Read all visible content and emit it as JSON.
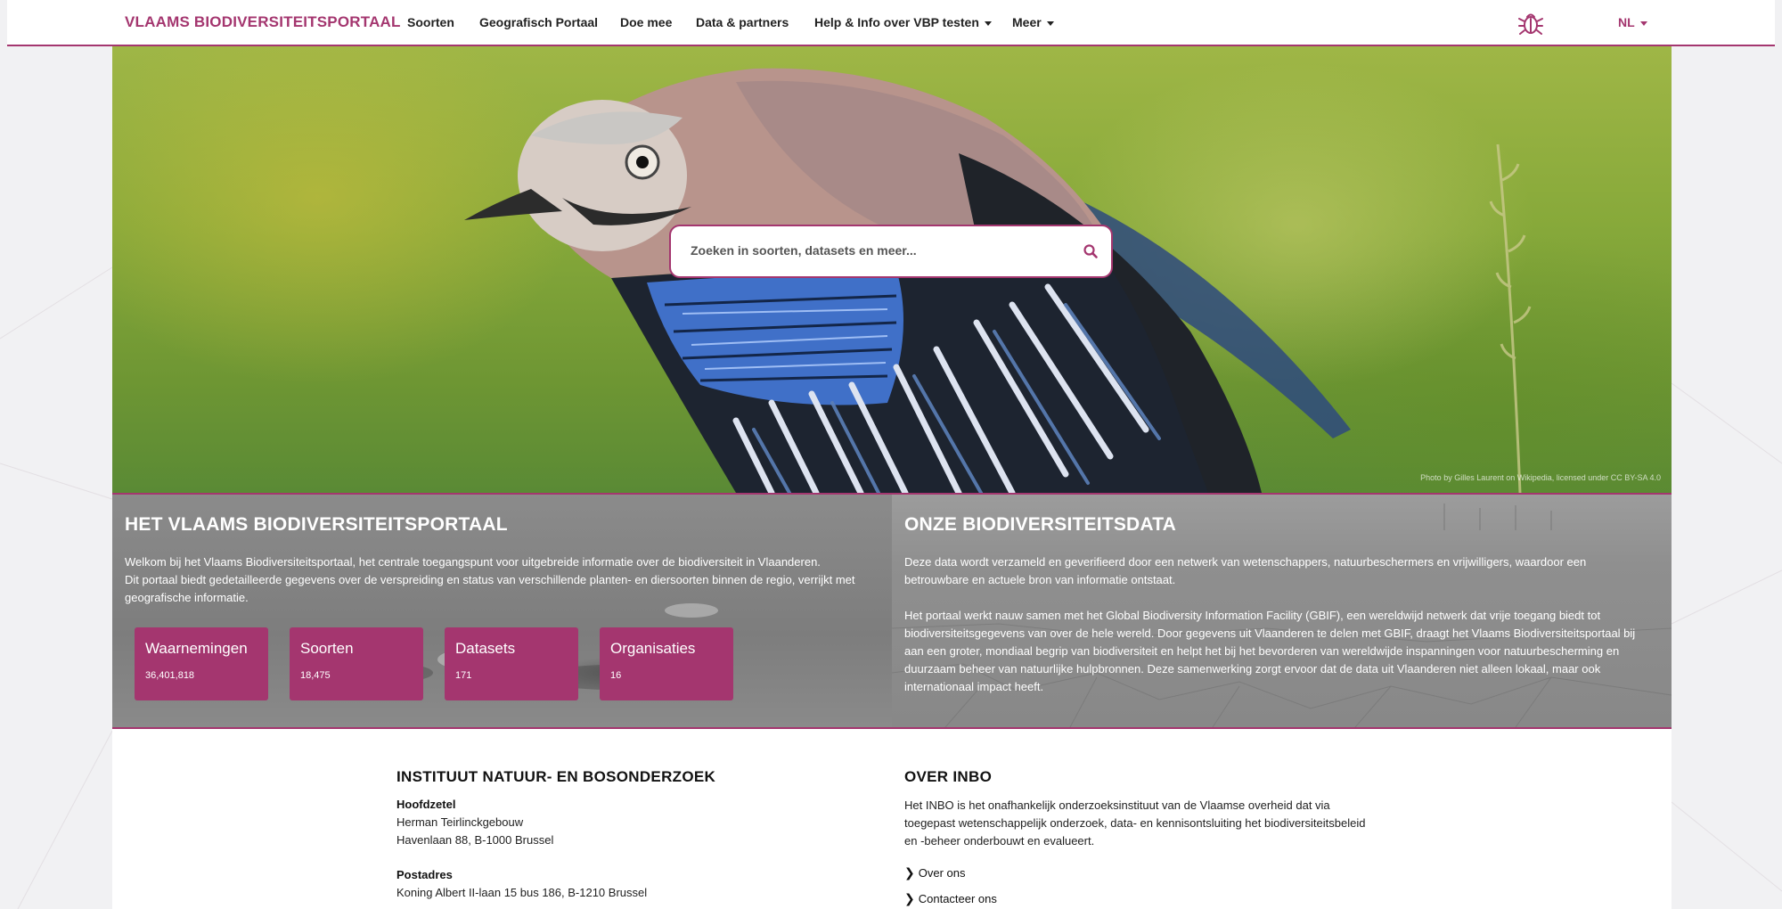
{
  "nav": {
    "brand": "VLAAMS BIODIVERSITEITSPORTAAL",
    "items": [
      {
        "label": "Soorten",
        "dropdown": false
      },
      {
        "label": "Geografisch Portaal",
        "dropdown": false
      },
      {
        "label": "Doe mee",
        "dropdown": false
      },
      {
        "label": "Data & partners",
        "dropdown": false
      },
      {
        "label": "Help & Info over VBP testen",
        "dropdown": true
      },
      {
        "label": "Meer",
        "dropdown": true
      }
    ],
    "language": "NL",
    "bug_icon": "bug-icon",
    "accent": "#a4366f"
  },
  "hero": {
    "search_placeholder": "Zoeken in soorten, datasets en meer...",
    "photo_credit": "Photo by Gilles Laurent on Wikipedia, licensed under CC BY-SA 4.0"
  },
  "intro": {
    "title": "HET VLAAMS BIODIVERSITEITSPORTAAL",
    "paragraph1": "Welkom bij het Vlaams Biodiversiteitsportaal, het centrale toegangspunt voor uitgebreide informatie over de biodiversiteit in Vlaanderen.",
    "paragraph2_line1": "Dit portaal biedt gedetailleerde gegevens over de verspreiding en status van verschillende planten- en diersoorten binnen de regio, verrijkt met",
    "paragraph2_line2": "geografische informatie.",
    "stats": [
      {
        "label": "Waarnemingen",
        "value": "36,401,818"
      },
      {
        "label": "Soorten",
        "value": "18,475"
      },
      {
        "label": "Datasets",
        "value": "171"
      },
      {
        "label": "Organisaties",
        "value": "16"
      }
    ]
  },
  "data_section": {
    "title": "ONZE BIODIVERSITEITSDATA",
    "p1_l1": "Deze data wordt verzameld en geverifieerd door een netwerk van wetenschappers, natuurbeschermers en vrijwilligers, waardoor een",
    "p1_l2": "betrouwbare en actuele bron van informatie ontstaat.",
    "p2_l1": "Het portaal werkt nauw samen met het Global Biodiversity Information Facility (GBIF), een wereldwijd netwerk dat vrije toegang biedt tot",
    "p2_l2": "biodiversiteitsgegevens van over de hele wereld. Door gegevens uit Vlaanderen te delen met GBIF, draagt het Vlaams Biodiversiteitsportaal bij",
    "p2_l3": "aan een groter, mondiaal begrip van biodiversiteit en helpt het bij het bevorderen van wereldwijde inspanningen voor natuurbescherming en",
    "p2_l4": "duurzaam beheer van natuurlijke hulpbronnen. Deze samenwerking zorgt ervoor dat de data uit Vlaanderen niet alleen lokaal, maar ook",
    "p2_l5": "internationaal impact heeft."
  },
  "footer": {
    "inbo_title": "INSTITUUT NATUUR- EN BOSONDERZOEK",
    "hq_label": "Hoofdzetel",
    "hq_line1": "Herman Teirlinckgebouw",
    "hq_line2": "Havenlaan 88, B-1000 Brussel",
    "postal_label": "Postadres",
    "postal_line1": "Koning Albert II-laan 15 bus 186, B-1210 Brussel",
    "about_title": "OVER INBO",
    "about_l1": "Het INBO is het onafhankelijk onderzoeksinstituut van de Vlaamse overheid dat via",
    "about_l2": "toegepast wetenschappelijk onderzoek, data- en kennisontsluiting het biodiversiteitsbeleid",
    "about_l3": "en -beheer onderbouwt en evalueert.",
    "links": [
      "Over ons",
      "Contacteer ons"
    ]
  }
}
